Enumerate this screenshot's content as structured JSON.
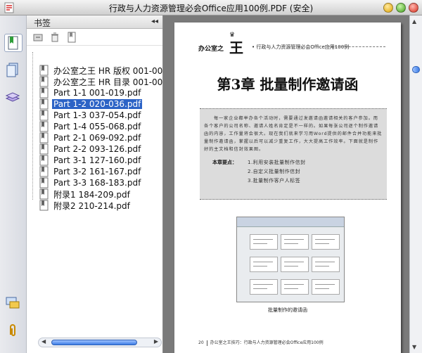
{
  "window": {
    "title": "行政与人力资源管理必会Office应用100例.PDF (安全)"
  },
  "panel": {
    "title": "书签",
    "collapse_glyph": "◂◂",
    "bookmarks": [
      {
        "label": "办公室之王 HR 版权 001-004.pdf",
        "selected": false
      },
      {
        "label": "办公室之王 HR 目录 001-006.pdf",
        "selected": false
      },
      {
        "label": "Part 1-1 001-019.pdf",
        "selected": false
      },
      {
        "label": "Part 1-2 020-036.pdf",
        "selected": true
      },
      {
        "label": "Part 1-3 037-054.pdf",
        "selected": false
      },
      {
        "label": "Part 1-4 055-068.pdf",
        "selected": false
      },
      {
        "label": "Part 2-1 069-092.pdf",
        "selected": false
      },
      {
        "label": "Part 2-2 093-126.pdf",
        "selected": false
      },
      {
        "label": "Part 3-1 127-160.pdf",
        "selected": false
      },
      {
        "label": "Part 3-2 161-167.pdf",
        "selected": false
      },
      {
        "label": "Part 3-3 168-183.pdf",
        "selected": false
      },
      {
        "label": "附录1 184-209.pdf",
        "selected": false
      },
      {
        "label": "附录2 210-214.pdf",
        "selected": false
      }
    ]
  },
  "page": {
    "brand_prefix": "办公室之",
    "brand_king": "王",
    "crown_glyph": "♛",
    "brand_sub": "• 行政与人力资源管理必会Office应用100例",
    "chapter_title": "第3章  批量制作邀请函",
    "intro_text": "每一家企业都举办各个活动时，需要通过发邀请函邀请相关的客户参加。而各个客户的公司名称、邀请人姓名肯定是不一样的。如果每张公司逐个制作邀请函的内容，工作量将会很大。现在我们就来学习用Word提供的邮件合并功能来批量制作邀请函，掌握以后可以减少重复工作，大大提高工作效率。下面就是制作好的主文档和信封效果图。",
    "points_label": "本章要点：",
    "points": [
      "1.利用安装批量制作信封",
      "2.自定义批量制作信封",
      "3.批量制作客户人标签"
    ],
    "figure_caption": "批量制作的邀请函",
    "footer_page": "20",
    "footer_text": "办公室之王技巧：行政与人力资源管理必会Office应用100例"
  }
}
